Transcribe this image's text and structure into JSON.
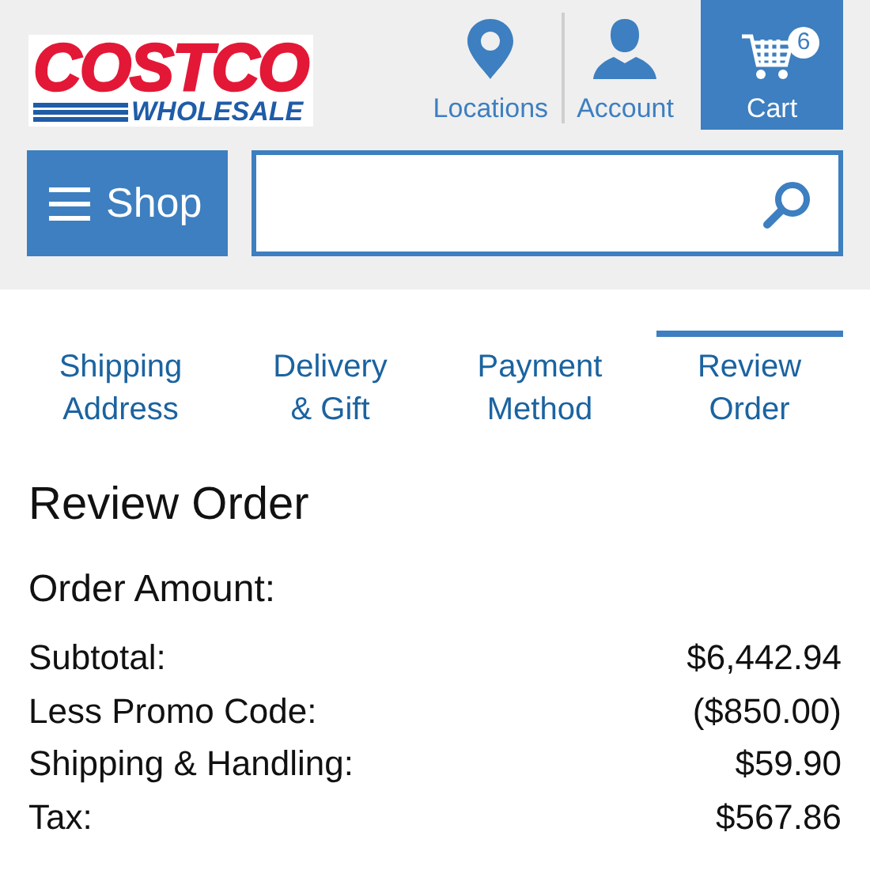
{
  "logo": {
    "top": "COSTCO",
    "bottom": "WHOLESALE"
  },
  "nav": [
    {
      "kind": "locations",
      "label": "Locations",
      "selected": false
    },
    {
      "kind": "account",
      "label": "Account",
      "selected": false
    },
    {
      "kind": "cart",
      "label": "Cart",
      "selected": true,
      "count": "6"
    }
  ],
  "shop_button": {
    "label": "Shop"
  },
  "tabs": [
    {
      "label": "Shipping Address",
      "selected": false
    },
    {
      "label": "Delivery & Gift",
      "selected": false
    },
    {
      "label": "Payment Method",
      "selected": false
    },
    {
      "label": "Review Order",
      "selected": true
    }
  ],
  "heading": "Review Order",
  "order_amount": {
    "title": "Order Amount:",
    "rows": [
      {
        "label": "Subtotal:",
        "value": "$6,442.94"
      },
      {
        "label": "Less Promo Code:",
        "value": "($850.00)"
      },
      {
        "label": "Shipping & Handling:",
        "value": "$59.90"
      },
      {
        "label": "Tax:",
        "value": "$567.86"
      }
    ]
  }
}
